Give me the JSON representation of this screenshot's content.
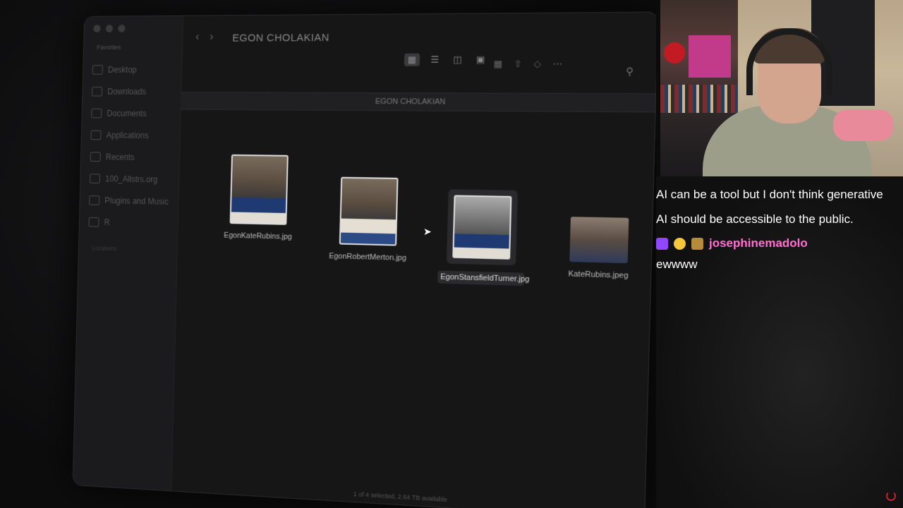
{
  "finder": {
    "title": "EGON CHOLAKIAN",
    "path_title": "EGON CHOLAKIAN",
    "sidebar_heading": "Favorites",
    "sidebar_items": [
      "Desktop",
      "Downloads",
      "Documents",
      "Applications",
      "Recents",
      "100_Allstrs.org",
      "Plugins and Music",
      "R"
    ],
    "sidebar_heading2": "Locations",
    "files": [
      {
        "name": "EgonKateRubins.jpg"
      },
      {
        "name": "EgonRobertMerton.jpg"
      },
      {
        "name": "EgonStansfieldTurner.jpg"
      },
      {
        "name": "KateRubins.jpeg"
      }
    ],
    "status": "1 of 4 selected, 2.64 TB available"
  },
  "chat": {
    "message1": "AI can be a tool but I don't think generative AI should be accessible to the public.",
    "username": "josephinemadolo",
    "message2": "ewwww"
  }
}
